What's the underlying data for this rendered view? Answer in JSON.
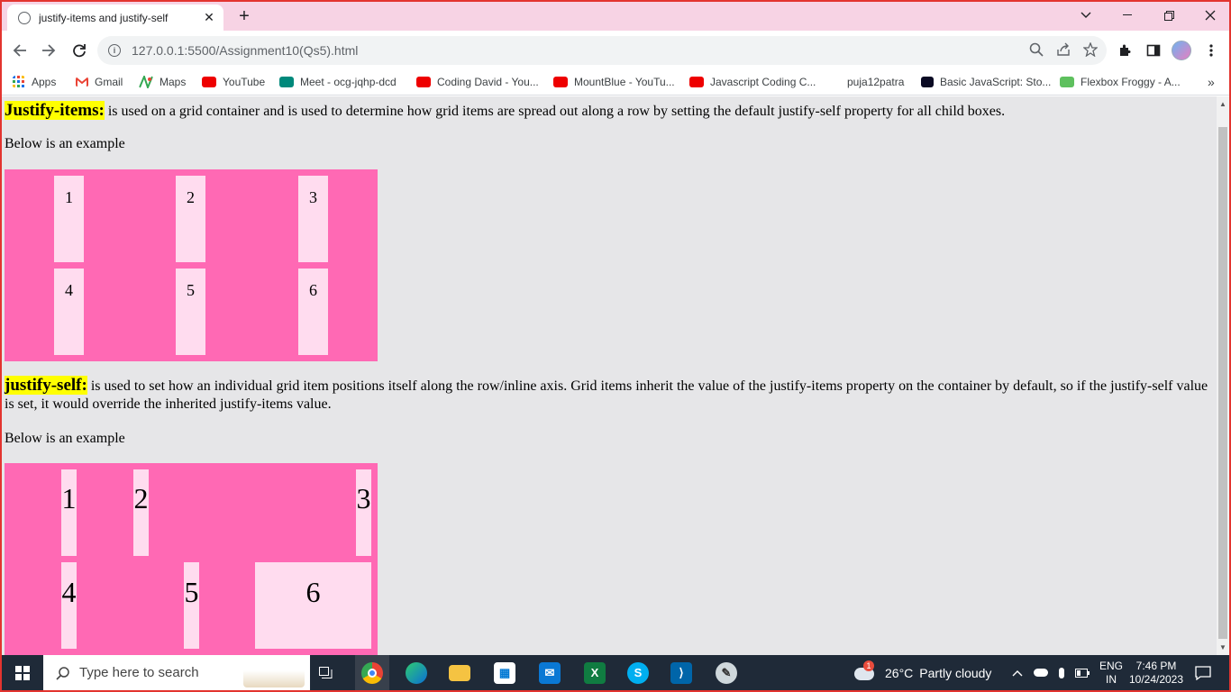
{
  "browser": {
    "tab_title": "justify-items and justify-self",
    "tab_close": "✕",
    "new_tab": "+",
    "url": "127.0.0.1:5500/Assignment10(Qs5).html"
  },
  "bookmarks": [
    {
      "label": "Apps"
    },
    {
      "label": "Gmail"
    },
    {
      "label": "Maps"
    },
    {
      "label": "YouTube"
    },
    {
      "label": "Meet - ocg-jqhp-dcd"
    },
    {
      "label": "Coding David - You..."
    },
    {
      "label": "MountBlue - YouTu..."
    },
    {
      "label": "Javascript Coding C..."
    },
    {
      "label": "puja12patra"
    },
    {
      "label": "Basic JavaScript: Sto..."
    },
    {
      "label": "Flexbox Froggy - A..."
    }
  ],
  "content": {
    "section1": {
      "term": "Justify-items:",
      "text": " is used on a grid container and is used to determine how grid items are spread out along a row by setting the default justify-self property for all child boxes.",
      "example_label": "Below is an example",
      "items": [
        "1",
        "2",
        "3",
        "4",
        "5",
        "6"
      ]
    },
    "section2": {
      "term": "justify-self:",
      "text": " is used to set how an individual grid item positions itself along the row/inline axis. Grid items inherit the value of the justify-items property on the container by default, so if the justify-self value is set, it would override the inherited justify-items value.",
      "example_label": "Below is an example",
      "items": [
        "1",
        "2",
        "3",
        "4",
        "5",
        "6"
      ]
    }
  },
  "colors": {
    "grid_background": "#ff69b4",
    "grid_item": "#ffdcef",
    "highlight": "#ffff00",
    "page_background": "#e6e6e8"
  },
  "taskbar": {
    "search_placeholder": "Type here to search",
    "weather_temp": "26°C",
    "weather_desc": "Partly cloudy",
    "lang": "ENG",
    "region": "IN",
    "time": "7:46 PM",
    "date": "10/24/2023",
    "weather_badge": "1"
  }
}
